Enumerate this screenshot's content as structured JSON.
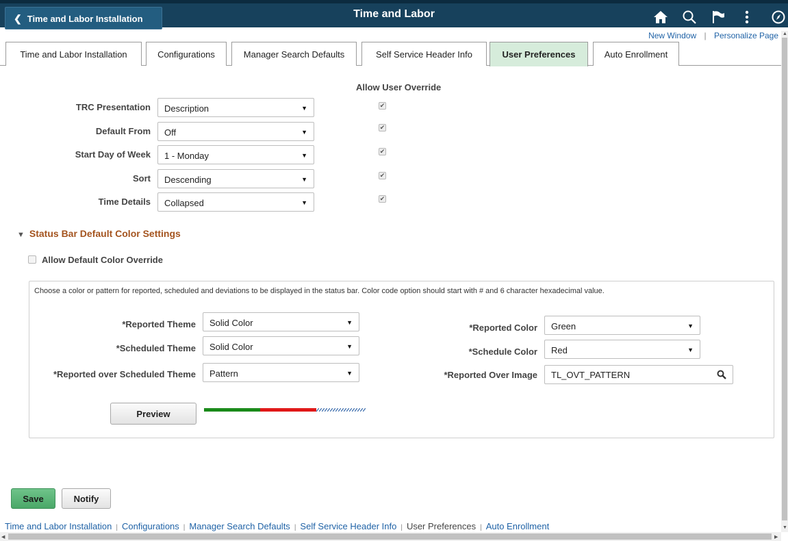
{
  "header": {
    "back_label": "Time and Labor Installation",
    "title": "Time and Labor"
  },
  "icons": {
    "home": "home-icon",
    "search": "search-icon",
    "flag": "flag-icon",
    "menu": "actions-menu-icon",
    "navbar": "navbar-compass-icon"
  },
  "links": {
    "new_window": "New Window",
    "personalize": "Personalize Page",
    "separator": "|"
  },
  "tabs": [
    {
      "label": "Time and Labor Installation"
    },
    {
      "label": "Configurations"
    },
    {
      "label": "Manager Search Defaults"
    },
    {
      "label": "Self Service Header Info"
    },
    {
      "label": "User Preferences"
    },
    {
      "label": "Auto Enrollment"
    }
  ],
  "prefs": {
    "override_heading": "Allow User Override",
    "rows": [
      {
        "label": "TRC Presentation",
        "value": "Description",
        "override": true
      },
      {
        "label": "Default From",
        "value": "Off",
        "override": true
      },
      {
        "label": "Start Day of Week",
        "value": "1 - Monday",
        "override": true
      },
      {
        "label": "Sort",
        "value": "Descending",
        "override": true
      },
      {
        "label": "Time Details",
        "value": "Collapsed",
        "override": true
      }
    ]
  },
  "status_bar": {
    "title": "Status Bar Default Color Settings",
    "allow_override_label": "Allow Default Color Override",
    "allow_override_checked": false,
    "instructions": "Choose a color or pattern for reported, scheduled and deviations to be displayed in the status bar. Color code option should start with # and 6 character hexadecimal value.",
    "reported_theme": {
      "label": "*Reported Theme",
      "value": "Solid Color"
    },
    "scheduled_theme": {
      "label": "*Scheduled Theme",
      "value": "Solid Color"
    },
    "over_theme": {
      "label": "*Reported over Scheduled Theme",
      "value": "Pattern"
    },
    "reported_color": {
      "label": "*Reported Color",
      "value": "Green"
    },
    "schedule_color": {
      "label": "*Schedule Color",
      "value": "Red"
    },
    "over_image": {
      "label": "*Reported Over Image",
      "value": "TL_OVT_PATTERN"
    },
    "preview_label": "Preview",
    "preview_colors": {
      "reported": "#1a8a1a",
      "scheduled": "#e01818",
      "pattern": "#3f6fae"
    }
  },
  "actions": {
    "save": "Save",
    "notify": "Notify"
  },
  "bottom_links": [
    {
      "label": "Time and Labor Installation"
    },
    {
      "label": "Configurations"
    },
    {
      "label": "Manager Search Defaults"
    },
    {
      "label": "Self Service Header Info"
    },
    {
      "label": "User Preferences"
    },
    {
      "label": "Auto Enrollment"
    }
  ],
  "bottom_separator": "|",
  "colors": {
    "header_bg": "#17415c",
    "active_tab_bg": "#d6ecdb",
    "section_title": "#a4541f",
    "link": "#1f62a6",
    "save_button": "#4aa868"
  }
}
